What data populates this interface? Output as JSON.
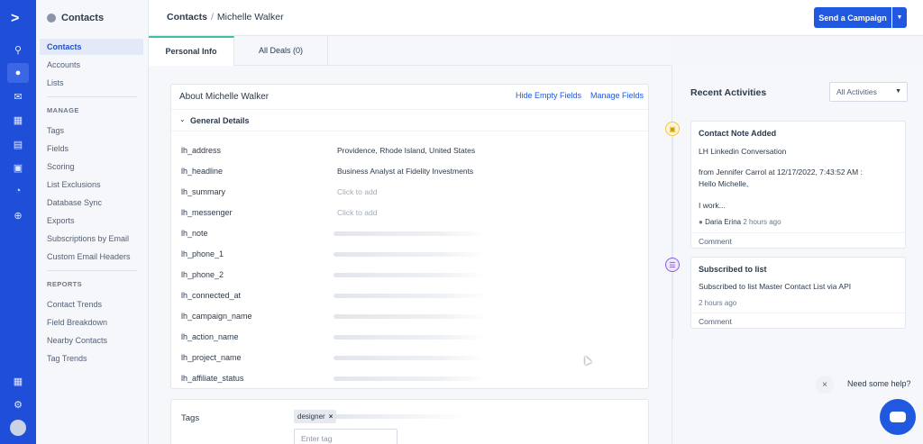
{
  "rail": {
    "items": [
      "search-icon",
      "contacts-icon",
      "email-icon",
      "automations-icon",
      "deals-icon",
      "website-icon",
      "reports-icon",
      "add-icon",
      "apps-icon",
      "settings-icon"
    ]
  },
  "sidenav": {
    "title": "Contacts",
    "items": [
      "Contacts",
      "Accounts",
      "Lists"
    ],
    "manage_title": "MANAGE",
    "manage": [
      "Tags",
      "Fields",
      "Scoring",
      "List Exclusions",
      "Database Sync",
      "Exports",
      "Subscriptions by Email",
      "Custom Email Headers"
    ],
    "reports_title": "REPORTS",
    "reports": [
      "Contact Trends",
      "Field Breakdown",
      "Nearby Contacts",
      "Tag Trends"
    ]
  },
  "header": {
    "crumb_root": "Contacts",
    "crumb_sep": "/",
    "crumb_current": "Michelle Walker",
    "send_campaign": "Send a Campaign"
  },
  "tabs": [
    "Personal Info",
    "All Deals (0)"
  ],
  "about": {
    "title": "About Michelle Walker",
    "hide_empty": "Hide Empty Fields",
    "manage_fields": "Manage Fields",
    "section": "General Details",
    "fields": [
      {
        "label": "lh_address",
        "value": "Providence, Rhode Island, United States"
      },
      {
        "label": "lh_headline",
        "value": "Business Analyst at Fidelity Investments"
      },
      {
        "label": "lh_summary",
        "value": "Click to add"
      },
      {
        "label": "lh_messenger",
        "value": "Click to add"
      },
      {
        "label": "lh_note",
        "value": ""
      },
      {
        "label": "lh_phone_1",
        "value": ""
      },
      {
        "label": "lh_phone_2",
        "value": ""
      },
      {
        "label": "lh_connected_at",
        "value": ""
      },
      {
        "label": "lh_campaign_name",
        "value": ""
      },
      {
        "label": "lh_action_name",
        "value": ""
      },
      {
        "label": "lh_project_name",
        "value": ""
      },
      {
        "label": "lh_affiliate_status",
        "value": ""
      }
    ]
  },
  "tags": {
    "label": "Tags",
    "chip": "designer",
    "chip_remove": "×",
    "placeholder": "Enter tag"
  },
  "activities": {
    "title": "Recent Activities",
    "filter": "All Activities",
    "items": [
      {
        "title": "Contact Note Added",
        "line1": "LH Linkedin Conversation",
        "line2": "from Jennifer Carrol at 12/17/2022, 7:43:52 AM :",
        "line3": "Hello Michelle,",
        "line4": "I work...",
        "author": "Daria Erina",
        "time": "2 hours ago",
        "comment": "Comment"
      },
      {
        "title": "Subscribed to list",
        "line1": "Subscribed to list Master Contact List via API",
        "time": "2 hours ago",
        "comment": "Comment"
      }
    ]
  },
  "help": {
    "text": "Need some help?",
    "close": "×"
  },
  "colors": {
    "brand": "#1f4ed8",
    "accent": "#2158e0",
    "tab_indicator": "#3bbfa6"
  }
}
